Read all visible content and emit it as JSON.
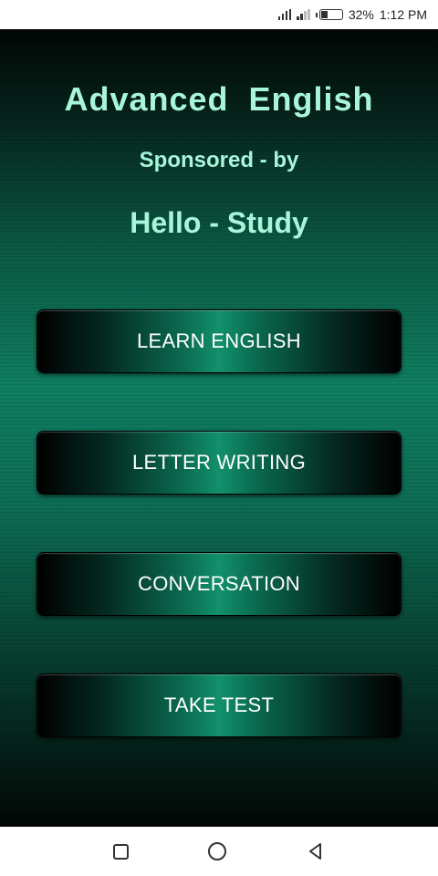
{
  "status_bar": {
    "battery_percent": "32%",
    "time": "1:12 PM",
    "battery_level": 0.32
  },
  "header": {
    "title": "Advanced  English",
    "sponsored_label": "Sponsored - by",
    "sponsor_name": "Hello - Study"
  },
  "menu": {
    "buttons": [
      {
        "label": "LEARN ENGLISH"
      },
      {
        "label": "LETTER WRITING"
      },
      {
        "label": "CONVERSATION"
      },
      {
        "label": "TAKE TEST"
      }
    ]
  },
  "nav_bar": {
    "icons": [
      "recent-apps-icon",
      "home-icon",
      "back-icon"
    ]
  },
  "colors": {
    "title_text": "#a8f5dc",
    "background_accent": "#0f7e60",
    "button_text": "#ffffff"
  }
}
